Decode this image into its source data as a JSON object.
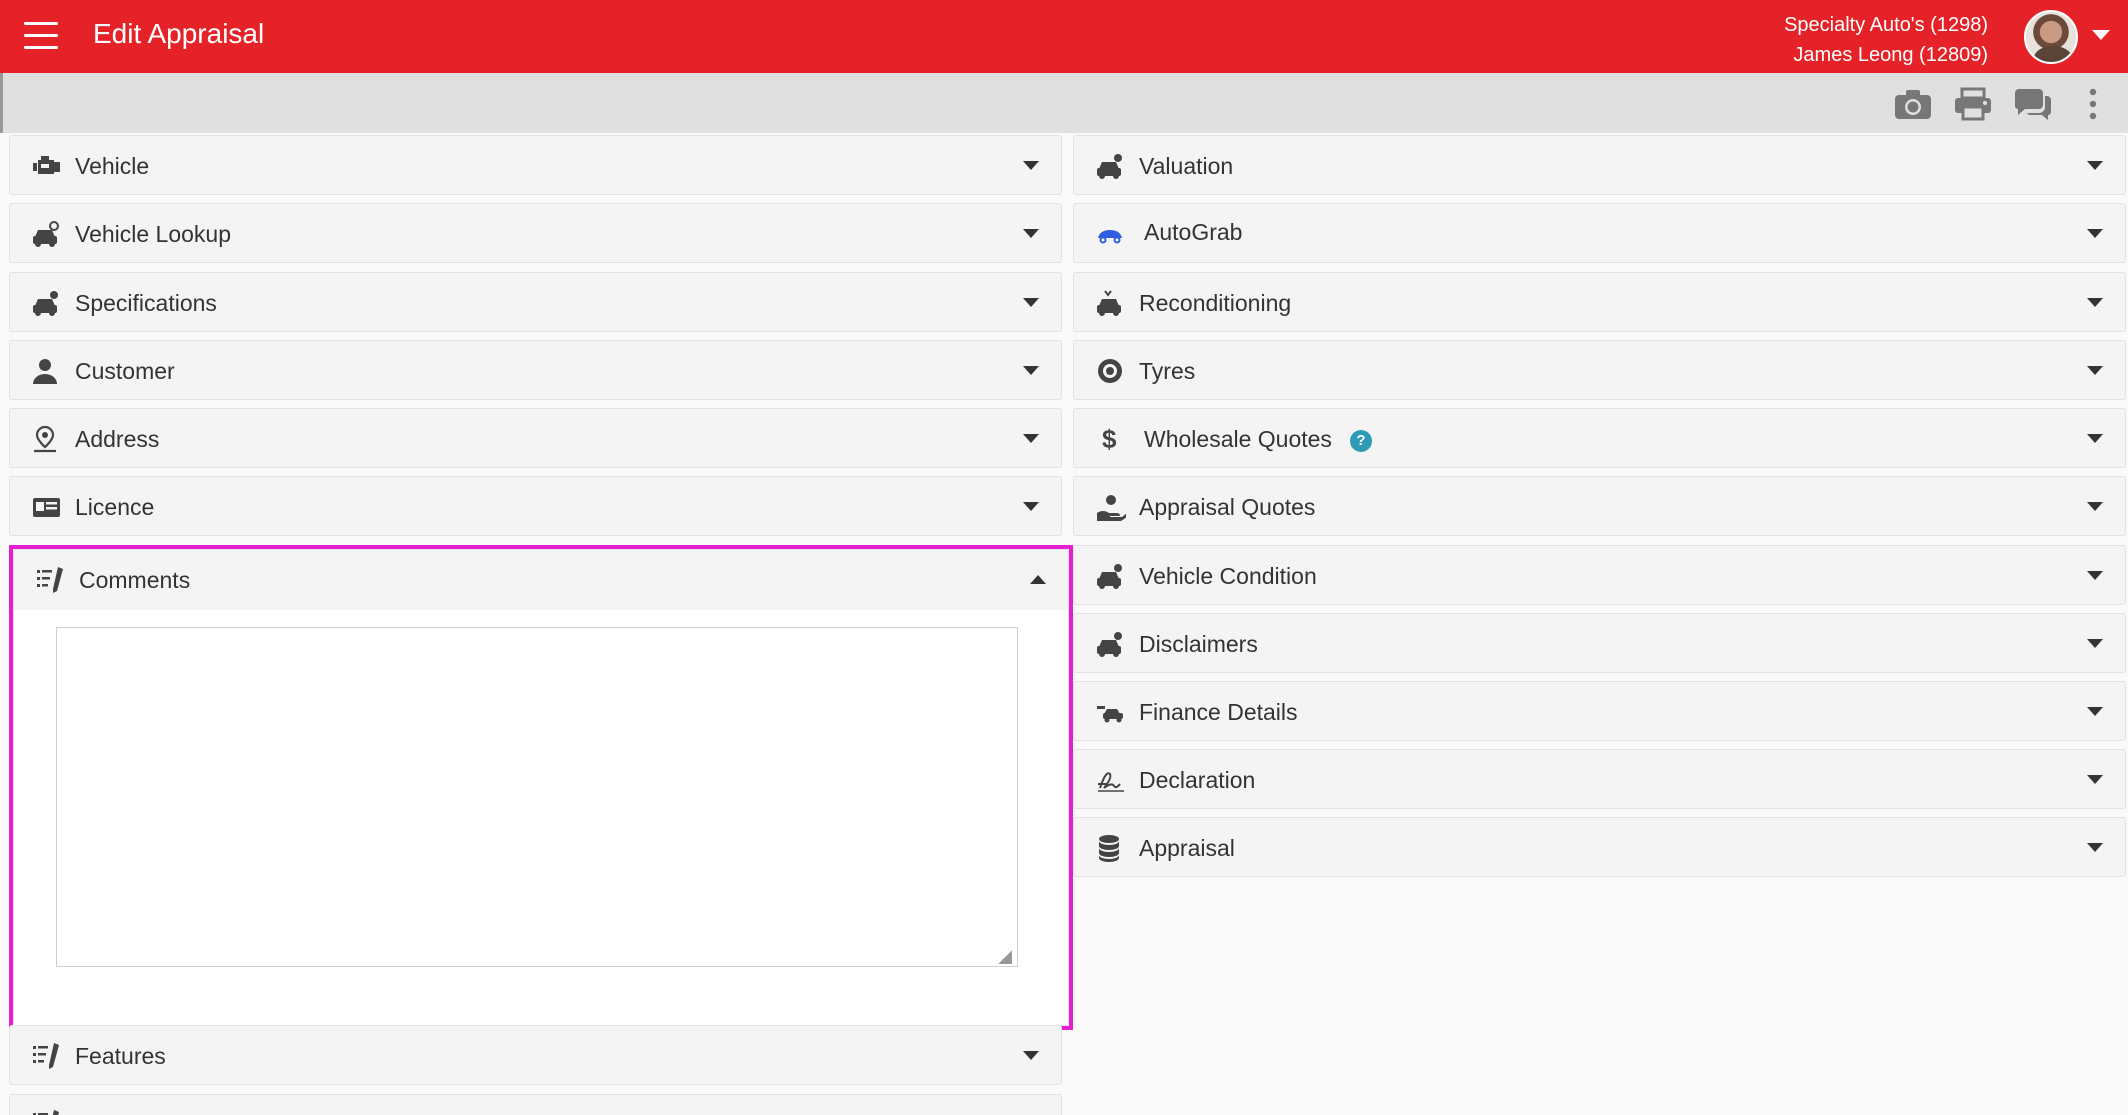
{
  "appbar": {
    "title": "Edit Appraisal",
    "dealer": "Specialty Auto's (1298)",
    "user": "James Leong (12809)"
  },
  "left_panels": [
    {
      "label": "Vehicle",
      "icon": "engine-icon"
    },
    {
      "label": "Vehicle Lookup",
      "icon": "car-search-icon"
    },
    {
      "label": "Specifications",
      "icon": "car-cog-icon"
    },
    {
      "label": "Customer",
      "icon": "user-icon"
    },
    {
      "label": "Address",
      "icon": "map-pin-user-icon"
    },
    {
      "label": "Licence",
      "icon": "id-card-icon"
    },
    {
      "label": "Comments",
      "icon": "list-pen-icon"
    },
    {
      "label": "Features",
      "icon": "list-pen-icon"
    }
  ],
  "right_panels": [
    {
      "label": "Valuation",
      "icon": "car-dollar-icon"
    },
    {
      "label": "AutoGrab",
      "icon": "autograb-car-icon"
    },
    {
      "label": "Reconditioning",
      "icon": "car-wrench-icon"
    },
    {
      "label": "Tyres",
      "icon": "tyre-icon"
    },
    {
      "label": "Wholesale Quotes",
      "icon": "dollar-icon"
    },
    {
      "label": "Appraisal Quotes",
      "icon": "hand-user-icon"
    },
    {
      "label": "Vehicle Condition",
      "icon": "car-cog-icon"
    },
    {
      "label": "Disclaimers",
      "icon": "car-info-icon"
    },
    {
      "label": "Finance Details",
      "icon": "car-money-icon"
    },
    {
      "label": "Declaration",
      "icon": "signature-icon"
    },
    {
      "label": "Appraisal",
      "icon": "database-icon"
    }
  ],
  "comments": {
    "value": ""
  },
  "help": {
    "label": "?"
  },
  "colors": {
    "brand": "#e52227",
    "highlight": "#e51ed2",
    "autograb": "#2f5fe0",
    "help": "#2d9bb5"
  }
}
